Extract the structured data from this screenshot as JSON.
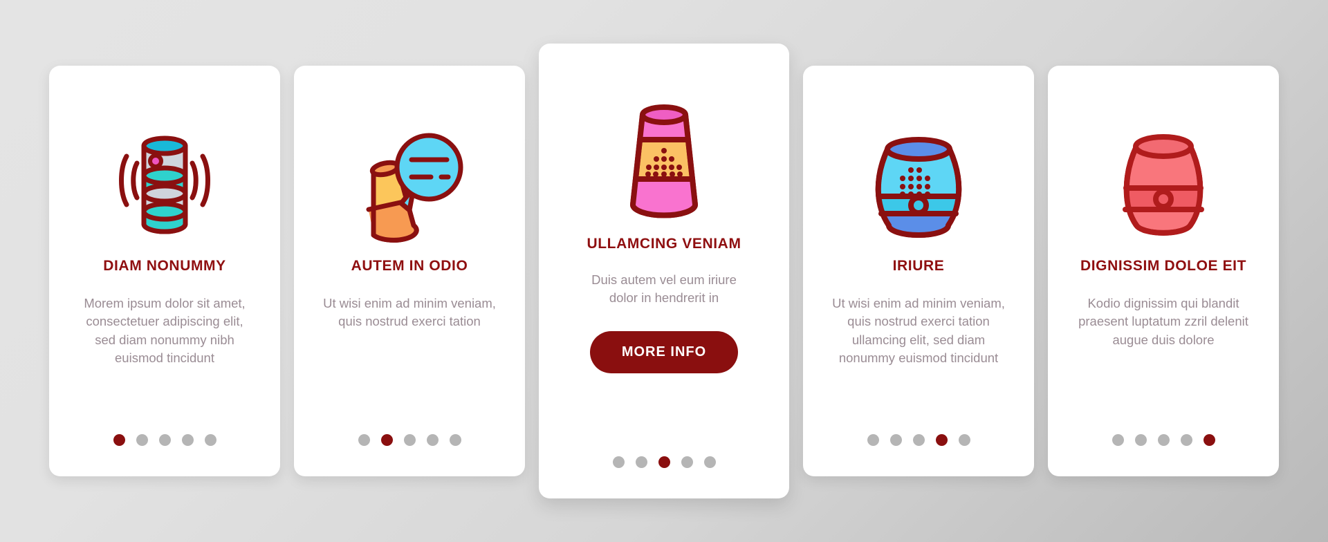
{
  "page": {
    "background_gradient_from": "#e4e4e4",
    "background_gradient_to": "#b9b9b9",
    "accent_color": "#8a0f0f",
    "body_text_color": "#9a8c94",
    "card_background": "#ffffff",
    "dot_inactive_color": "#b5b5b5"
  },
  "cards": [
    {
      "id": "card-1",
      "featured": false,
      "icon_name": "smart-speaker-cylinder-sound-waves-icon",
      "icon_colors": {
        "outline": "#8a1010",
        "body": "#cfd4dc",
        "band": "#2fd2cd",
        "top": "#19b9d8",
        "led": "#ee55c0"
      },
      "title": "DIAM NONUMMY",
      "body": "Morem ipsum dolor sit amet, consectetuer adipiscing elit, sed diam nonummy nibh euismod tincidunt",
      "dots": {
        "count": 5,
        "active_index": 0
      },
      "has_button": false
    },
    {
      "id": "card-2",
      "featured": false,
      "icon_name": "smart-speaker-voice-assistant-chat-bubble-icon",
      "icon_colors": {
        "outline": "#8a1010",
        "body": "#fcc65b",
        "base": "#f79a52",
        "bubble": "#5ed6f5"
      },
      "title": "AUTEM IN ODIO",
      "body": "Ut wisi enim ad minim veniam, quis nostrud exerci tation",
      "dots": {
        "count": 5,
        "active_index": 1
      },
      "has_button": false
    },
    {
      "id": "card-3",
      "featured": true,
      "icon_name": "smart-speaker-tapered-perforated-grille-icon",
      "icon_colors": {
        "outline": "#8a1010",
        "body": "#fbc164",
        "band": "#f973cf",
        "top": "#ef5ec3"
      },
      "title": "ULLAMCING VENIAM",
      "body": "Duis autem vel eum iriure dolor in hendrerit in",
      "dots": {
        "count": 5,
        "active_index": 2
      },
      "has_button": true,
      "button_label": "MORE INFO"
    },
    {
      "id": "card-4",
      "featured": false,
      "icon_name": "smart-speaker-barrel-dot-grille-button-icon",
      "icon_colors": {
        "outline": "#8a1010",
        "body": "#5ed6f5",
        "band": "#3cc8e8",
        "top": "#5b8ee8"
      },
      "title": "IRIURE",
      "body": "Ut wisi enim ad minim veniam, quis nostrud exerci tation ullamcing elit, sed diam nonummy euismod tincidunt",
      "dots": {
        "count": 5,
        "active_index": 3
      },
      "has_button": false
    },
    {
      "id": "card-5",
      "featured": false,
      "icon_name": "smart-speaker-barrel-center-band-button-icon",
      "icon_colors": {
        "outline": "#b01c1c",
        "body": "#f9767c",
        "band": "#ef5b63",
        "top": "#f26a72"
      },
      "title": "DIGNISSIM DOLOE EIT",
      "body": "Kodio dignissim qui blandit praesent luptatum zzril delenit augue duis dolore",
      "dots": {
        "count": 5,
        "active_index": 4
      },
      "has_button": false
    }
  ]
}
